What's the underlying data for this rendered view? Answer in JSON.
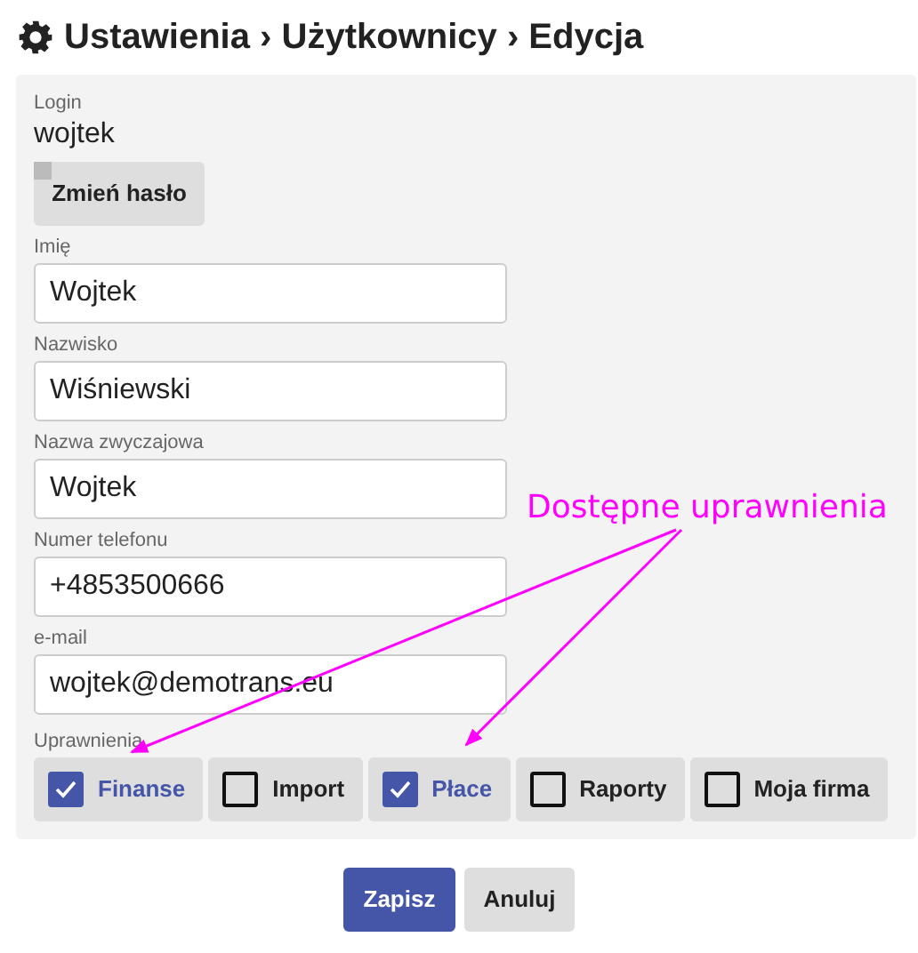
{
  "title": "Ustawienia › Użytkownicy › Edycja",
  "login": {
    "label": "Login",
    "value": "wojtek"
  },
  "change_password_button": "Zmień hasło",
  "fields": [
    {
      "label": "Imię",
      "value": "Wojtek"
    },
    {
      "label": "Nazwisko",
      "value": "Wiśniewski"
    },
    {
      "label": "Nazwa zwyczajowa",
      "value": "Wojtek"
    },
    {
      "label": "Numer telefonu",
      "value": "+4853500666"
    },
    {
      "label": "e-mail",
      "value": "wojtek@demotrans.eu"
    }
  ],
  "permissions": {
    "label": "Uprawnienia",
    "items": [
      {
        "label": "Finanse",
        "checked": true
      },
      {
        "label": "Import",
        "checked": false
      },
      {
        "label": "Płace",
        "checked": true
      },
      {
        "label": "Raporty",
        "checked": false
      },
      {
        "label": "Moja firma",
        "checked": false
      }
    ]
  },
  "annotation": "Dostępne uprawnienia",
  "buttons": [
    {
      "label": "Zapisz",
      "kind": "primary"
    },
    {
      "label": "Anuluj",
      "kind": "secondary"
    }
  ]
}
